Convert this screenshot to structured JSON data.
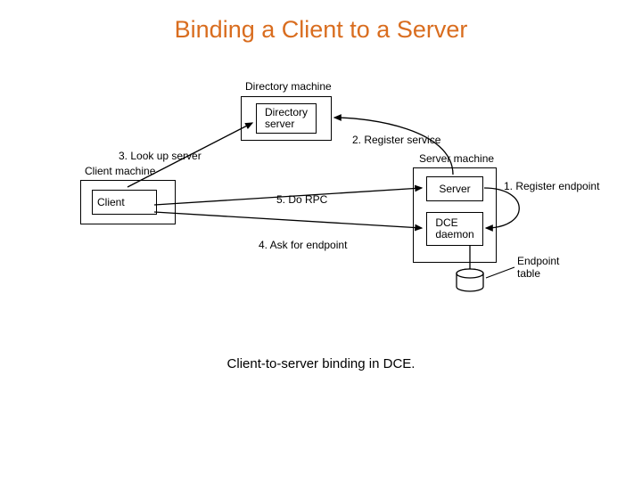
{
  "title": "Binding a Client to a Server",
  "caption": "Client-to-server binding in DCE.",
  "labels": {
    "directory_machine": "Directory machine",
    "directory_server": "Directory\nserver",
    "client_machine": "Client machine",
    "client": "Client",
    "server_machine": "Server machine",
    "server": "Server",
    "dce_daemon": "DCE\ndaemon",
    "endpoint_table": "Endpoint\ntable",
    "step1": "1. Register endpoint",
    "step2": "2. Register service",
    "step3": "3. Look up server",
    "step4": "4. Ask for endpoint",
    "step5": "5. Do RPC"
  }
}
